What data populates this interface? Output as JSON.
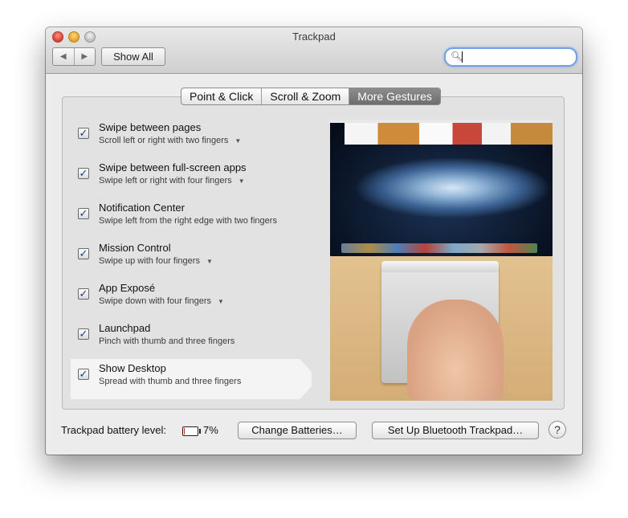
{
  "window": {
    "title": "Trackpad"
  },
  "toolbar": {
    "back_icon": "chevron-left-icon",
    "forward_icon": "chevron-right-icon",
    "show_all": "Show All",
    "search_value": "",
    "search_icon": "magnifier-icon"
  },
  "tabs": [
    {
      "label": "Point & Click",
      "active": false
    },
    {
      "label": "Scroll & Zoom",
      "active": false
    },
    {
      "label": "More Gestures",
      "active": true
    }
  ],
  "gestures": [
    {
      "title": "Swipe between pages",
      "subtitle": "Scroll left or right with two fingers",
      "checked": true,
      "has_options": true
    },
    {
      "title": "Swipe between full-screen apps",
      "subtitle": "Swipe left or right with four fingers",
      "checked": true,
      "has_options": true
    },
    {
      "title": "Notification Center",
      "subtitle": "Swipe left from the right edge with two fingers",
      "checked": true,
      "has_options": false
    },
    {
      "title": "Mission Control",
      "subtitle": "Swipe up with four fingers",
      "checked": true,
      "has_options": true
    },
    {
      "title": "App Exposé",
      "subtitle": "Swipe down with four fingers",
      "checked": true,
      "has_options": true
    },
    {
      "title": "Launchpad",
      "subtitle": "Pinch with thumb and three fingers",
      "checked": true,
      "has_options": false
    },
    {
      "title": "Show Desktop",
      "subtitle": "Spread with thumb and three fingers",
      "checked": true,
      "has_options": false,
      "selected": true
    }
  ],
  "footer": {
    "battery_label": "Trackpad battery level:",
    "battery_percent_text": "7%",
    "battery_level": 0.07,
    "change_batteries": "Change Batteries…",
    "setup_bluetooth": "Set Up Bluetooth Trackpad…",
    "help": "?"
  },
  "colors": {
    "accent": "#6fa2e6",
    "battery_low": "#d62b1f",
    "tab_active": "#7a7a7a"
  }
}
